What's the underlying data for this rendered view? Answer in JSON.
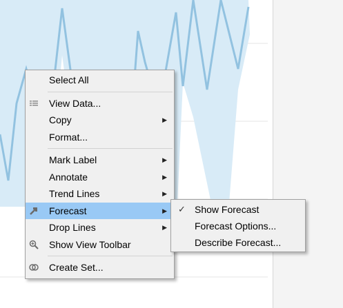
{
  "colors": {
    "band_fill": "#d8ebf7",
    "line": "#92c2e0",
    "grid": "#e6e6e6",
    "menu_bg": "#f0f0f0",
    "menu_highlight": "#99c9f5",
    "right_panel_bg": "#f4f4f4"
  },
  "context_menu": {
    "select_all": "Select All",
    "view_data": "View Data...",
    "view_data_icon": "table-icon",
    "copy": "Copy",
    "format": "Format...",
    "mark_label": "Mark Label",
    "annotate": "Annotate",
    "trend_lines": "Trend Lines",
    "forecast": "Forecast",
    "forecast_icon": "forecast-arrow-icon",
    "drop_lines": "Drop Lines",
    "show_view_toolbar": "Show View Toolbar",
    "show_view_toolbar_icon": "zoom-icon",
    "create_set": "Create Set...",
    "create_set_icon": "set-icon",
    "submenu_arrow": "▶"
  },
  "forecast_submenu": {
    "show_forecast": "Show Forecast",
    "show_forecast_checked": true,
    "check_mark": "✓",
    "forecast_options": "Forecast Options...",
    "describe_forecast": "Describe Forecast..."
  }
}
